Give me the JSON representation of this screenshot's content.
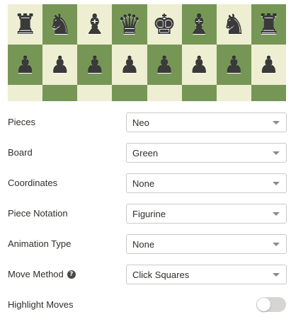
{
  "board_preview": {
    "back_rank": [
      {
        "glyph": "♜",
        "name": "rook"
      },
      {
        "glyph": "♞",
        "name": "knight"
      },
      {
        "glyph": "♝",
        "name": "bishop"
      },
      {
        "glyph": "♛",
        "name": "queen"
      },
      {
        "glyph": "♚",
        "name": "king"
      },
      {
        "glyph": "♝",
        "name": "bishop"
      },
      {
        "glyph": "♞",
        "name": "knight"
      },
      {
        "glyph": "♜",
        "name": "rook"
      }
    ],
    "pawn_glyph": "♟",
    "colors": {
      "light_square": "#eeeed2",
      "dark_square": "#769656",
      "piece": "#3a3a3a"
    }
  },
  "settings": {
    "pieces": {
      "label": "Pieces",
      "value": "Neo"
    },
    "board": {
      "label": "Board",
      "value": "Green"
    },
    "coordinates": {
      "label": "Coordinates",
      "value": "None"
    },
    "piece_notation": {
      "label": "Piece Notation",
      "value": "Figurine"
    },
    "animation_type": {
      "label": "Animation Type",
      "value": "None"
    },
    "move_method": {
      "label": "Move Method",
      "value": "Click Squares",
      "help_glyph": "?"
    },
    "highlight_moves": {
      "label": "Highlight Moves",
      "enabled": false
    }
  }
}
